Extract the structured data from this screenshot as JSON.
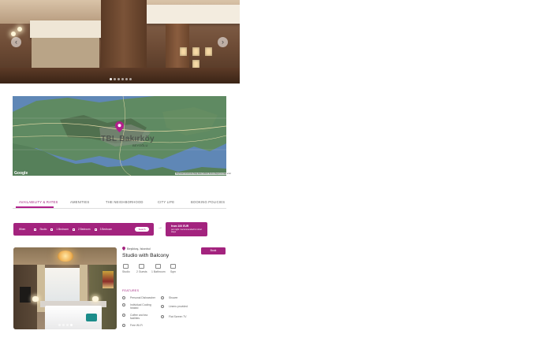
{
  "hero": {
    "prev_icon": "chevron-left-icon",
    "next_icon": "chevron-right-icon",
    "slides_count": 6,
    "active_slide": 1
  },
  "map": {
    "city_label": "TBL Bakırköy",
    "district_label": "BEYOĞLU",
    "provider": "Google",
    "attribution": "Keyboard shortcuts  Map data ©2024  Terms  Report a map error",
    "pin_icon": "map-pin-icon",
    "accent": "#a3237e"
  },
  "tabs": [
    {
      "label": "AVAILABILITY & RATES",
      "active": true
    },
    {
      "label": "AMENITIES",
      "active": false
    },
    {
      "label": "THE NEIGHBORHOOD",
      "active": false
    },
    {
      "label": "CITY LIFE",
      "active": false
    },
    {
      "label": "BOOKING POLICIES",
      "active": false
    }
  ],
  "booking": {
    "start_label": "When",
    "fields": [
      {
        "label": "Studio"
      },
      {
        "label": "1 Bedroom"
      },
      {
        "label": "2 Bedroom"
      },
      {
        "label": "3 Bedroom"
      }
    ],
    "button_label": "Search",
    "arrow_icon": "arrow-right-icon",
    "price_title": "from 100 EUR",
    "price_note": "per night / recommended for short stays"
  },
  "room": {
    "location": "Beşiktaş, İstanbul",
    "title": "Studio with Balcony",
    "book_label": "Book",
    "photo_dots": 4,
    "active_photo": 4,
    "specs": [
      {
        "icon": "home-icon",
        "label": "Studio"
      },
      {
        "icon": "guests-icon",
        "label": "2 Guests"
      },
      {
        "icon": "bed-icon",
        "label": "1 Bathroom"
      },
      {
        "icon": "size-icon",
        "label": "Sqm"
      }
    ],
    "features_title": "FEATURES",
    "features": [
      {
        "icon": "washer-icon",
        "label": "Personal Dishwasher"
      },
      {
        "icon": "shower-icon",
        "label": "Shower"
      },
      {
        "icon": "cooling-icon",
        "label": "Individual Cooling heated"
      },
      {
        "icon": "tub-icon",
        "label": "Linens provided"
      },
      {
        "icon": "coffee-icon",
        "label": "Coffee and tea facilities"
      },
      {
        "icon": "tv-icon",
        "label": "Flat Screen TV"
      },
      {
        "icon": "wifi-icon",
        "label": "Free Wi-Fi"
      }
    ]
  }
}
